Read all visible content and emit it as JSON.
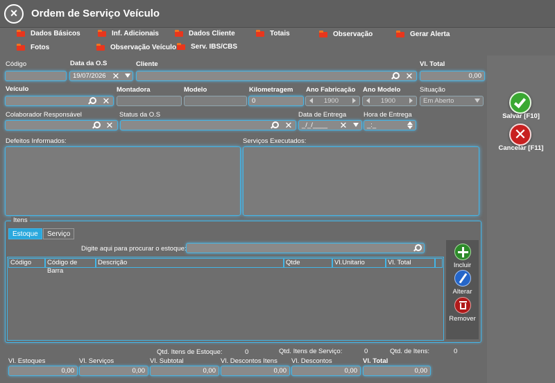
{
  "window": {
    "title": "Ordem de Serviço Veículo"
  },
  "nav_tabs": [
    "Dados Básicos",
    "Inf. Adicionais",
    "Dados Cliente",
    "Totais",
    "Observação",
    "Gerar Alerta",
    "Fotos",
    "Observação Veículo",
    "Serv. IBS/CBS"
  ],
  "header": {
    "codigo_label": "Código",
    "data_os_label": "Data da O.S",
    "data_os_value": "19/07/2026",
    "cliente_label": "Cliente",
    "vl_total_label": "Vl. Total",
    "vl_total_value": "0,00"
  },
  "vehicle": {
    "veiculo_label": "Veículo",
    "montadora_label": "Montadora",
    "modelo_label": "Modelo",
    "km_label": "Kilometragem",
    "km_value": "0",
    "ano_fab_label": "Ano Fabricação",
    "ano_fab_value": "1900",
    "ano_modelo_label": "Ano Modelo",
    "ano_modelo_value": "1900",
    "situacao_label": "Situação",
    "situacao_value": "Em Aberto"
  },
  "responsible": {
    "colaborador_label": "Colaborador Responsável",
    "status_label": "Status da O.S",
    "data_entrega_label": "Data de Entrega",
    "data_entrega_value": "_/_/____",
    "hora_entrega_label": "Hora de Entrega",
    "hora_entrega_value": "_:_"
  },
  "notes": {
    "defeitos_label": "Defeitos Informados:",
    "servicos_label": "Serviços Executados:"
  },
  "itens": {
    "group_label": "Itens",
    "tabs": [
      "Estoque",
      "Serviço"
    ],
    "search_label": "Digite aqui para procurar o estoque:",
    "columns": [
      "Código",
      "Código de Barra",
      "Descrição",
      "Qtde",
      "Vl.Unitario",
      "Vl. Total"
    ]
  },
  "actions": {
    "incluir": "Incluir",
    "alterar": "Alterar",
    "remover": "Remover"
  },
  "counts": {
    "qtd_estoque_label": "Qtd. Itens de Estoque:",
    "qtd_estoque_value": "0",
    "qtd_servico_label": "Qtd. Itens de Serviço:",
    "qtd_servico_value": "0",
    "qtd_itens_label": "Qtd. de Itens:",
    "qtd_itens_value": "0"
  },
  "totals": [
    {
      "label": "Vl. Estoques",
      "value": "0,00"
    },
    {
      "label": "Vl. Serviços",
      "value": "0,00"
    },
    {
      "label": "Vl. Subtotal",
      "value": "0,00"
    },
    {
      "label": "Vl. Descontos Itens",
      "value": "0,00"
    },
    {
      "label": "Vl. Descontos",
      "value": "0,00"
    },
    {
      "label": "Vl. Total",
      "value": "0,00"
    }
  ],
  "side_buttons": {
    "salvar": "Salvar [F10]",
    "cancelar": "Cancelar [F11]"
  },
  "colors": {
    "accent": "#43b5e6",
    "salvar": "#3aa832",
    "cancelar": "#c82020",
    "tab_icon": "#e8361d"
  }
}
